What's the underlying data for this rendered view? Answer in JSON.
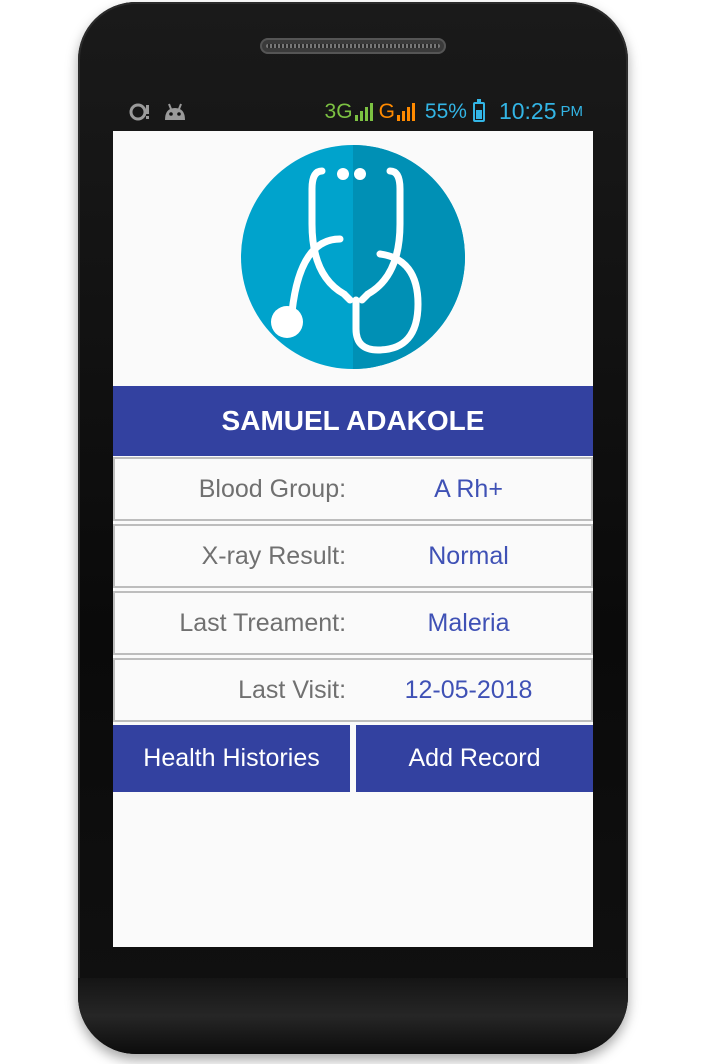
{
  "status_bar": {
    "network_3g": "3G",
    "network_g": "G",
    "battery_percent": "55%",
    "time": "10:25",
    "ampm": "PM",
    "left_icons": [
      "notification-icon",
      "android-debug-icon"
    ]
  },
  "profile": {
    "logo_icon": "stethoscope-icon",
    "name": "SAMUEL ADAKOLE"
  },
  "details": [
    {
      "label": "Blood Group:",
      "value": "A Rh+"
    },
    {
      "label": "X-ray Result:",
      "value": "Normal"
    },
    {
      "label": "Last Treament:",
      "value": "Maleria"
    },
    {
      "label": "Last Visit:",
      "value": "12-05-2018"
    }
  ],
  "actions": {
    "histories_label": "Health Histories",
    "add_record_label": "Add Record"
  },
  "colors": {
    "primary": "#3341a0",
    "value_text": "#3f51b5",
    "logo_circle": "#00a3cc",
    "status_text": "#33b5e5"
  }
}
